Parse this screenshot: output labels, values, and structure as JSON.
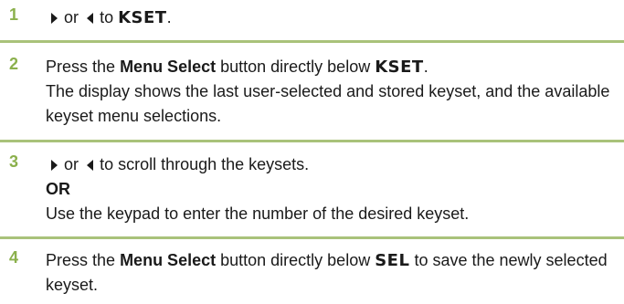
{
  "colors": {
    "step_number": "#8bb04c",
    "rule": "#a9c27a",
    "text": "#1a1a1a"
  },
  "steps": [
    {
      "number": "1",
      "right_arrow_icon": "right-triangle-arrow",
      "or": "or",
      "left_arrow_icon": "left-triangle-arrow",
      "to": "to",
      "kset": "KSET",
      "period": "."
    },
    {
      "number": "2",
      "press": "Press the",
      "menu_select": "Menu Select",
      "button_below": "button directly below",
      "kset": "KSET",
      "period": ".",
      "description": "The display shows the last user-selected and stored keyset, and the available keyset menu selections."
    },
    {
      "number": "3",
      "right_arrow_icon": "right-triangle-arrow",
      "or": "or",
      "left_arrow_icon": "left-triangle-arrow",
      "scroll_text": "to scroll through the keysets.",
      "or_bold": "OR",
      "keypad_text": "Use the keypad to enter the number of the desired keyset."
    },
    {
      "number": "4",
      "press": "Press the",
      "menu_select": "Menu Select",
      "button_below": "button directly below",
      "sel": "SEL",
      "save_text": "to save the newly selected keyset."
    }
  ]
}
